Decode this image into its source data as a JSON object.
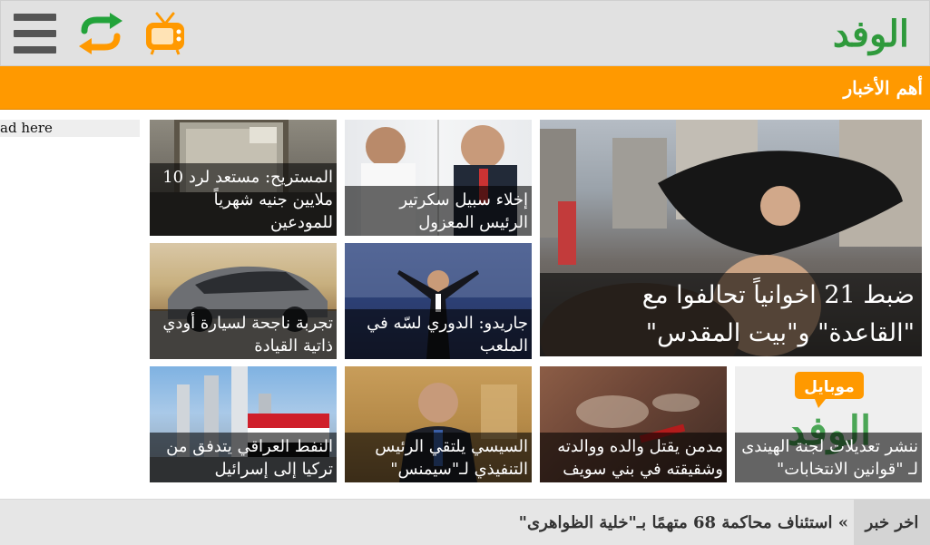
{
  "header": {
    "logo_text": "الوفد",
    "icons": [
      "menu-icon",
      "refresh-icon",
      "tv-icon"
    ],
    "colors": {
      "bar": "#e1e1e1",
      "menu": "#555555",
      "refresh": "#22a33a",
      "refresh_alt": "#ff9900",
      "tv": "#ff9900",
      "logo": "#2f9a3c"
    }
  },
  "section": {
    "title": "أهم الأخبار",
    "color": "#ff9900"
  },
  "ad": {
    "text": "ad here"
  },
  "news": {
    "featured": {
      "title": "ضبط 21 اخوانياً تحالفوا مع \"القاعدة\" و\"بيت المقدس\""
    },
    "tiles": [
      {
        "title": "إخلاء سبيل سكرتير الرئيس المعزول"
      },
      {
        "title": "المستريح: مستعد لرد 10 ملايين جنيه شهرياً للمودعين"
      },
      {
        "title": "جاريدو: الدوري لسّه في الملعب"
      },
      {
        "title": "تجربة ناجحة لسيارة أودي ذاتية القيادة"
      },
      {
        "title": "ننشر تعديلات لجنة الهيندى لـ \"قوانين الانتخابات\"",
        "badge": "موبايل"
      },
      {
        "title": "مدمن يقتل والده ووالدته وشقيقته في بني سويف"
      },
      {
        "title": "السيسي يلتقي الرئيس التنفيذي لـ\"سيمنس\""
      },
      {
        "title": "النفط العراقي يتدفق من تركيا إلى إسرائيل"
      }
    ]
  },
  "ticker": {
    "label": "اخر خبر",
    "text": "» استئناف محاكمة 68 متهمًا بـ\"خلية الظواهرى\""
  }
}
